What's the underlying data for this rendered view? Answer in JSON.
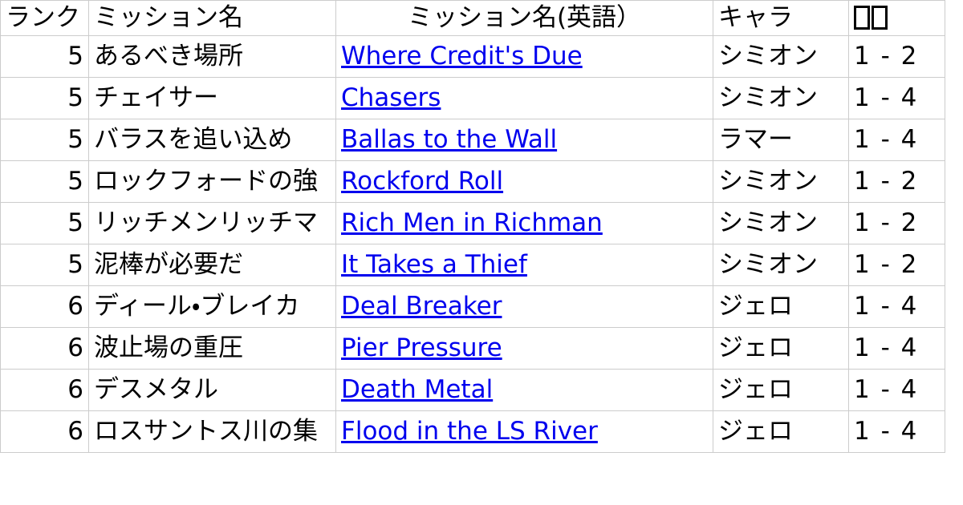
{
  "table": {
    "columns": [
      {
        "key": "rank",
        "label": "ランク",
        "align": "right"
      },
      {
        "key": "jp",
        "label": "ミッション名",
        "align": "left"
      },
      {
        "key": "en",
        "label": "ミッション名(英語）",
        "align": "left"
      },
      {
        "key": "char",
        "label": "キャラ",
        "align": "left"
      },
      {
        "key": "extra",
        "label": "",
        "align": "left",
        "label_is_missing_glyph": true,
        "missing_glyph_count": 2
      }
    ],
    "rows": [
      {
        "rank": "5",
        "jp": "あるべき場所",
        "en": "Where Credit's Due",
        "char": "シミオン",
        "extra": "1 - 2"
      },
      {
        "rank": "5",
        "jp": "チェイサー",
        "en": "Chasers",
        "char": "シミオン",
        "extra": "1 - 4"
      },
      {
        "rank": "5",
        "jp": "バラスを追い込め",
        "en": "Ballas to the Wall",
        "char": "ラマー",
        "extra": "1 - 4"
      },
      {
        "rank": "5",
        "jp": "ロックフォードの強",
        "en": "Rockford Roll",
        "char": "シミオン",
        "extra": "1 - 2"
      },
      {
        "rank": "5",
        "jp": "リッチメンリッチマ",
        "en": "Rich Men in Richman",
        "char": "シミオン",
        "extra": "1 - 2"
      },
      {
        "rank": "5",
        "jp": "泥棒が必要だ",
        "en": "It Takes a Thief",
        "char": "シミオン",
        "extra": "1 - 2"
      },
      {
        "rank": "6",
        "jp": "ディール・ブレイカ",
        "en": "Deal Breaker",
        "char": "ジェロ",
        "extra": "1 - 4"
      },
      {
        "rank": "6",
        "jp": "波止場の重圧",
        "en": "Pier Pressure",
        "char": "ジェロ",
        "extra": "1 - 4"
      },
      {
        "rank": "6",
        "jp": "デスメタル",
        "en": "Death Metal",
        "char": "ジェロ",
        "extra": "1 - 4"
      },
      {
        "rank": "6",
        "jp": "ロスサントス川の集",
        "en": "Flood in the LS River",
        "char": "ジェロ",
        "extra": "1 - 4"
      }
    ]
  },
  "colors": {
    "link": "#0000ee",
    "border": "#cccccc",
    "text": "#000000",
    "background": "#ffffff"
  }
}
